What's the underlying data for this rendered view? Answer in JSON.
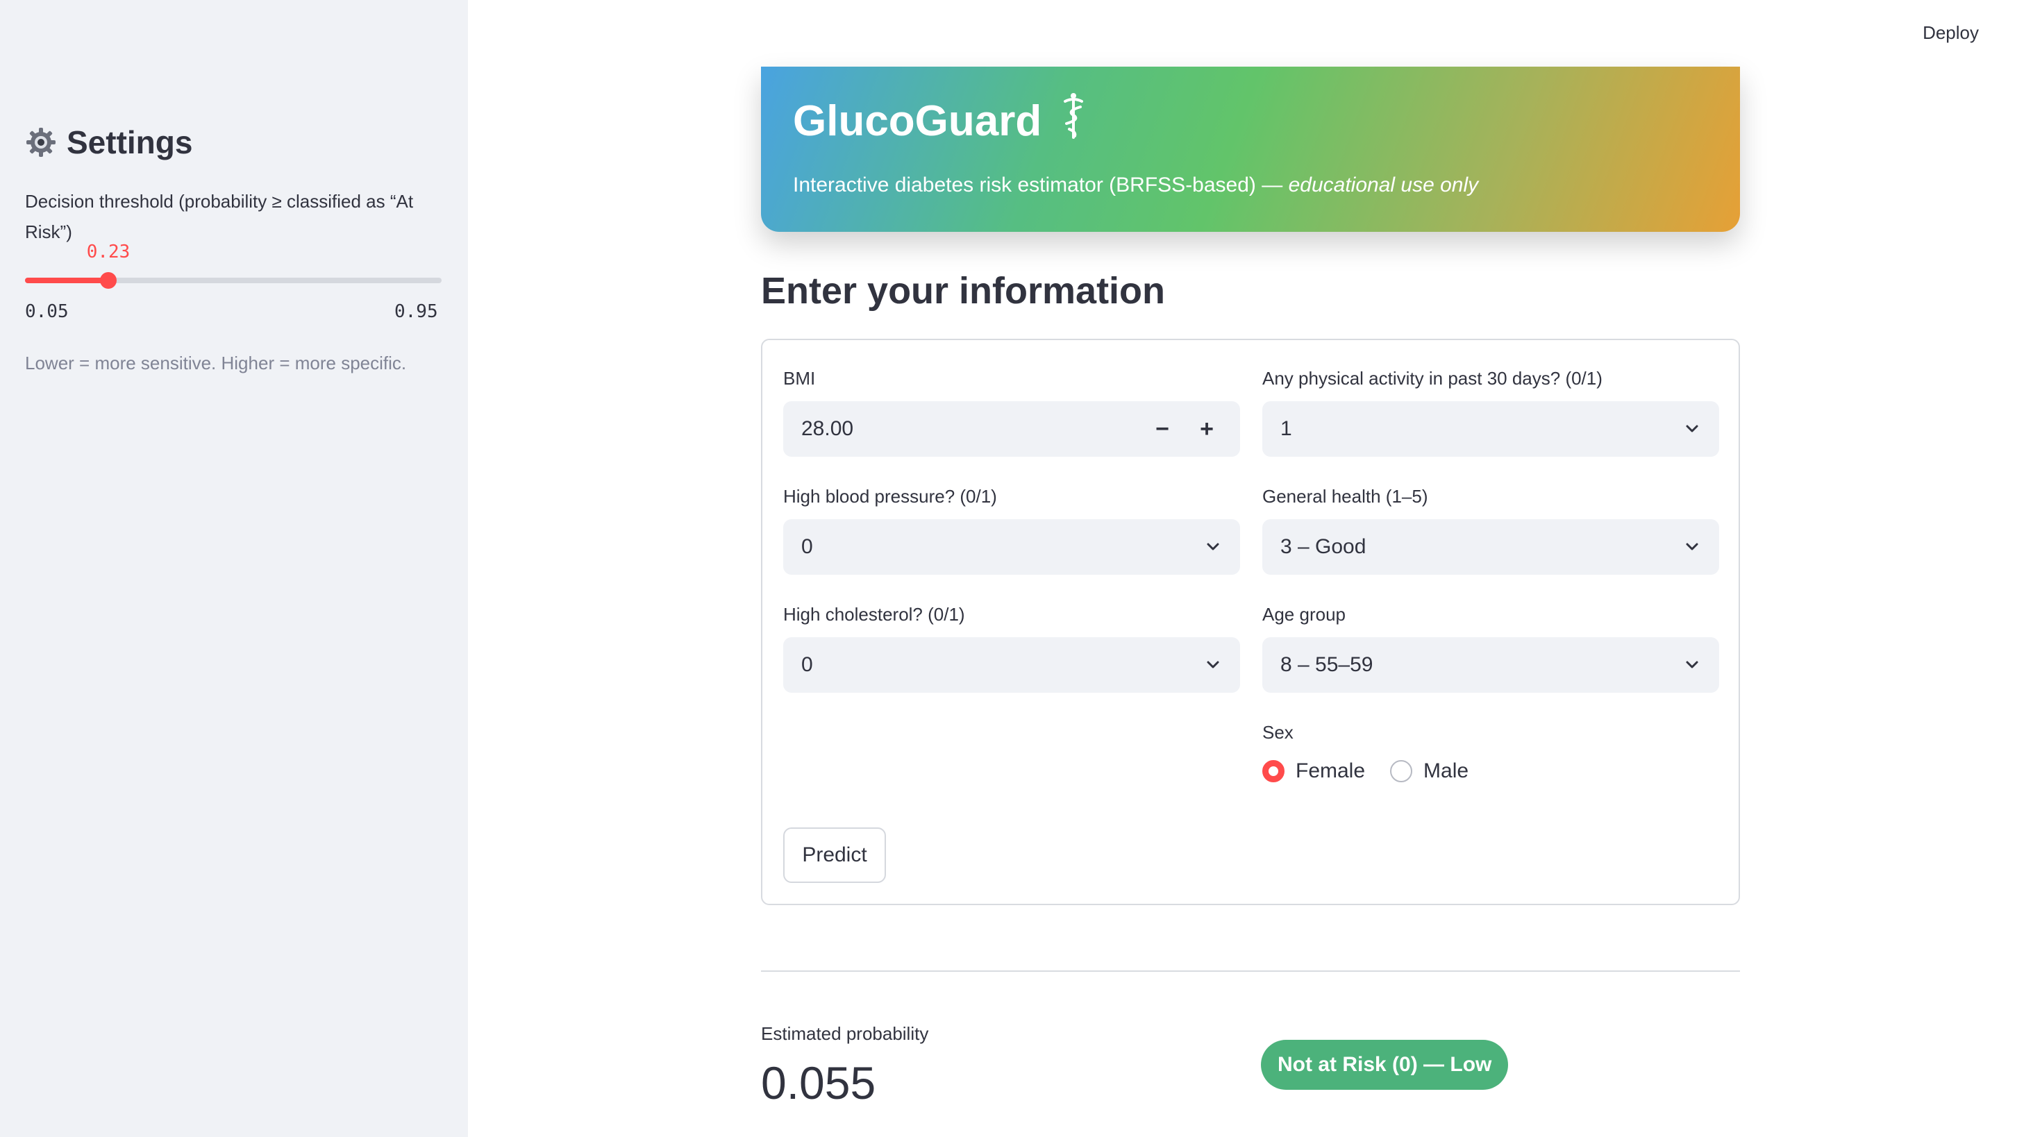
{
  "topbar": {
    "deploy_label": "Deploy"
  },
  "sidebar": {
    "title": "Settings",
    "icon": "gear-icon",
    "threshold": {
      "label": "Decision threshold (probability ≥ classified as “At Risk”)",
      "value": 0.23,
      "value_text": "0.23",
      "min": 0.05,
      "min_text": "0.05",
      "max": 0.95,
      "max_text": "0.95"
    },
    "help": "Lower = more sensitive. Higher = more specific."
  },
  "banner": {
    "title": "GlucoGuard",
    "icon": "caduceus-icon",
    "subtitle_main": "Interactive diabetes risk estimator (BRFSS-based) — ",
    "subtitle_italic": "educational use only"
  },
  "form": {
    "section_title": "Enter your information",
    "bmi": {
      "label": "BMI",
      "value": "28.00",
      "minus": "−",
      "plus": "+"
    },
    "phys_activity": {
      "label": "Any physical activity in past 30 days? (0/1)",
      "value": "1"
    },
    "high_bp": {
      "label": "High blood pressure? (0/1)",
      "value": "0"
    },
    "gen_health": {
      "label": "General health (1–5)",
      "value": "3 – Good"
    },
    "high_chol": {
      "label": "High cholesterol? (0/1)",
      "value": "0"
    },
    "age_group": {
      "label": "Age group",
      "value": "8 – 55–59"
    },
    "sex": {
      "label": "Sex",
      "options": [
        "Female",
        "Male"
      ],
      "selected": "Female"
    },
    "predict_label": "Predict"
  },
  "result": {
    "prob_label": "Estimated probability",
    "prob_value": "0.055",
    "badge": "Not at Risk (0) — Low"
  },
  "colors": {
    "accent": "#ff4b4b",
    "badge_green": "#4cb27b",
    "sidebar_bg": "#f0f2f6"
  }
}
